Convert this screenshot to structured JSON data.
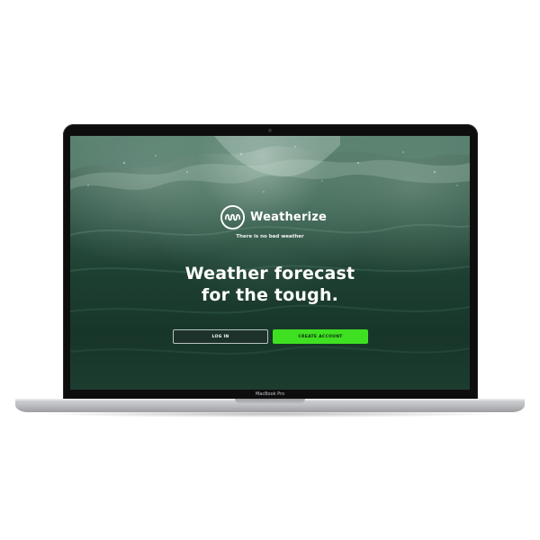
{
  "device": {
    "model_label": "MacBook Pro"
  },
  "app": {
    "brand_name": "Weatherize",
    "logo_icon": "wave-logo-icon",
    "tagline": "There is no bad weather",
    "headline_line1": "Weather forecast",
    "headline_line2": "for the tough.",
    "buttons": {
      "login_label": "LOG IN",
      "create_account_label": "CREATE ACCOUNT"
    },
    "colors": {
      "accent": "#3fe021",
      "background_sea": "#1d3f31",
      "text": "#ffffff"
    }
  }
}
